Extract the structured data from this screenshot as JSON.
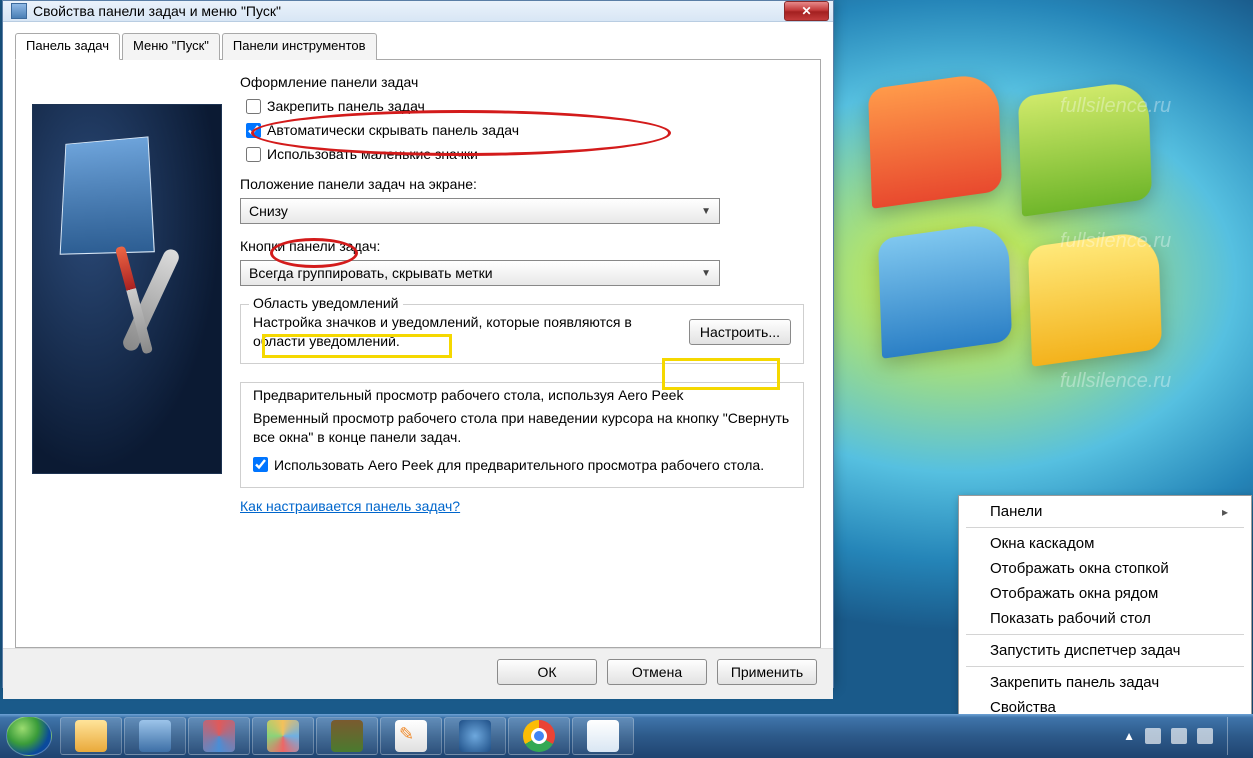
{
  "watermark": "fullsilence.ru",
  "dialog": {
    "title": "Свойства панели задач и меню \"Пуск\"",
    "tabs": [
      "Панель задач",
      "Меню \"Пуск\"",
      "Панели инструментов"
    ],
    "section_appearance": "Оформление панели задач",
    "chk_lock": "Закрепить панель задач",
    "chk_autohide": "Автоматически скрывать панель задач",
    "chk_small_icons": "Использовать маленькие значки",
    "label_position": "Положение панели задач на экране:",
    "dropdown_position": "Снизу",
    "label_buttons": "Кнопки панели задач:",
    "dropdown_buttons": "Всегда группировать, скрывать метки",
    "notif_legend": "Область уведомлений",
    "notif_desc": "Настройка значков и уведомлений, которые появляются в области уведомлений.",
    "notif_btn": "Настроить...",
    "aero_legend": "Предварительный просмотр рабочего стола, используя Aero Peek",
    "aero_desc": "Временный просмотр рабочего стола при наведении курсора на кнопку \"Свернуть все окна\" в конце панели задач.",
    "aero_chk": "Использовать Aero Peek для предварительного просмотра рабочего стола.",
    "help_link": "Как настраивается панель задач?",
    "btn_ok": "ОК",
    "btn_cancel": "Отмена",
    "btn_apply": "Применить"
  },
  "context_menu": {
    "items": [
      "Панели",
      "Окна каскадом",
      "Отображать окна стопкой",
      "Отображать окна рядом",
      "Показать рабочий стол",
      "Запустить диспетчер задач",
      "Закрепить панель задач",
      "Свойства"
    ]
  },
  "taskbar": {
    "items": [
      "explorer",
      "control-panel",
      "snipping",
      "paint",
      "minecraft",
      "hex-editor",
      "thunderbird",
      "chrome",
      "notepad"
    ],
    "time": "",
    "tray_icons": 4
  }
}
